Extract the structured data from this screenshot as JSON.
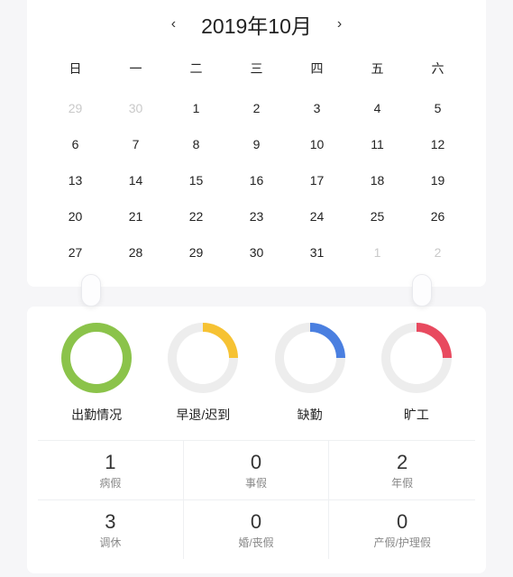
{
  "calendar": {
    "title": "2019年10月",
    "prev_glyph": "‹",
    "next_glyph": "›",
    "dow": [
      "日",
      "一",
      "二",
      "三",
      "四",
      "五",
      "六"
    ],
    "days": [
      {
        "d": "29",
        "muted": true
      },
      {
        "d": "30",
        "muted": true
      },
      {
        "d": "1"
      },
      {
        "d": "2"
      },
      {
        "d": "3"
      },
      {
        "d": "4"
      },
      {
        "d": "5"
      },
      {
        "d": "6"
      },
      {
        "d": "7"
      },
      {
        "d": "8"
      },
      {
        "d": "9"
      },
      {
        "d": "10"
      },
      {
        "d": "11"
      },
      {
        "d": "12"
      },
      {
        "d": "13"
      },
      {
        "d": "14"
      },
      {
        "d": "15"
      },
      {
        "d": "16"
      },
      {
        "d": "17"
      },
      {
        "d": "18"
      },
      {
        "d": "19"
      },
      {
        "d": "20"
      },
      {
        "d": "21"
      },
      {
        "d": "22"
      },
      {
        "d": "23"
      },
      {
        "d": "24"
      },
      {
        "d": "25"
      },
      {
        "d": "26"
      },
      {
        "d": "27"
      },
      {
        "d": "28"
      },
      {
        "d": "29"
      },
      {
        "d": "30"
      },
      {
        "d": "31"
      },
      {
        "d": "1",
        "muted": true
      },
      {
        "d": "2",
        "muted": true
      }
    ]
  },
  "rings": [
    {
      "label": "出勤情况",
      "style": "full",
      "color": "#8bc34a"
    },
    {
      "label": "早退/迟到",
      "style": "q",
      "color": "#f6c233"
    },
    {
      "label": "缺勤",
      "style": "q",
      "color": "#4a7fe0"
    },
    {
      "label": "旷工",
      "style": "q",
      "color": "#e84a5f"
    }
  ],
  "counts": [
    {
      "value": "1",
      "label": "病假"
    },
    {
      "value": "0",
      "label": "事假"
    },
    {
      "value": "2",
      "label": "年假"
    },
    {
      "value": "3",
      "label": "调休"
    },
    {
      "value": "0",
      "label": "婚/丧假"
    },
    {
      "value": "0",
      "label": "产假/护理假"
    }
  ]
}
